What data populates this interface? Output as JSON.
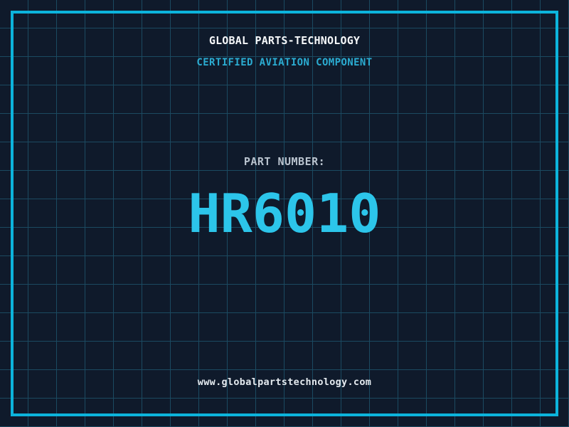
{
  "header": {
    "title": "GLOBAL PARTS-TECHNOLOGY",
    "subtitle": "CERTIFIED AVIATION COMPONENT"
  },
  "part": {
    "label": "PART NUMBER:",
    "number": "HR6010"
  },
  "footer": {
    "website": "www.globalpartstechnology.com"
  },
  "colors": {
    "background": "#0f1a2b",
    "grid_line": "#1b4a61",
    "frame_border": "#0cb4dc",
    "title_text": "#f5f7f9",
    "subtitle_text": "#2bacd2",
    "part_label_text": "#b9c3ce",
    "part_number_text": "#2cc5ea",
    "website_text": "#e4eaef"
  }
}
